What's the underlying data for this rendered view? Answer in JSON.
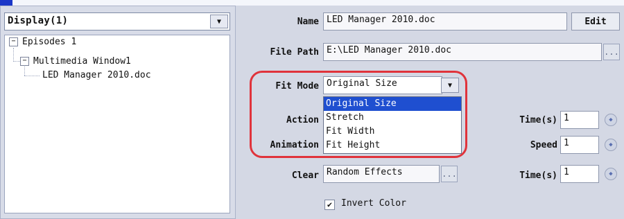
{
  "left": {
    "combo_value": "Display(1)",
    "tree": {
      "items": [
        {
          "label": "Episodes 1",
          "expander": "−"
        },
        {
          "label": "Multimedia Window1",
          "expander": "−"
        },
        {
          "label": "LED Manager 2010.doc"
        }
      ]
    }
  },
  "form": {
    "name_label": "Name",
    "name_value": "LED Manager 2010.doc",
    "edit_label": "Edit",
    "filepath_label": "File Path",
    "filepath_value": "E:\\LED Manager 2010.doc",
    "browse_label": "...",
    "fitmode_label": "Fit Mode",
    "fitmode_value": "Original Size",
    "fitmode_options": [
      "Original Size",
      "Stretch",
      "Fit Width",
      "Fit Height"
    ],
    "action_label": "Action",
    "animation_label": "Animation",
    "clear_label": "Clear",
    "clear_value": "Random Effects",
    "clear_browse_label": "...",
    "time_label": "Time(s)",
    "time1_value": "1",
    "speed_label": "Speed",
    "speed_value": "1",
    "time2_label": "Time(s)",
    "time2_value": "1",
    "invert_label": "Invert Color",
    "invert_checked": true
  },
  "colors": {
    "highlight_ring": "#e0333b",
    "selection": "#1f4fd0",
    "brand_mark": "#1a36c8"
  }
}
